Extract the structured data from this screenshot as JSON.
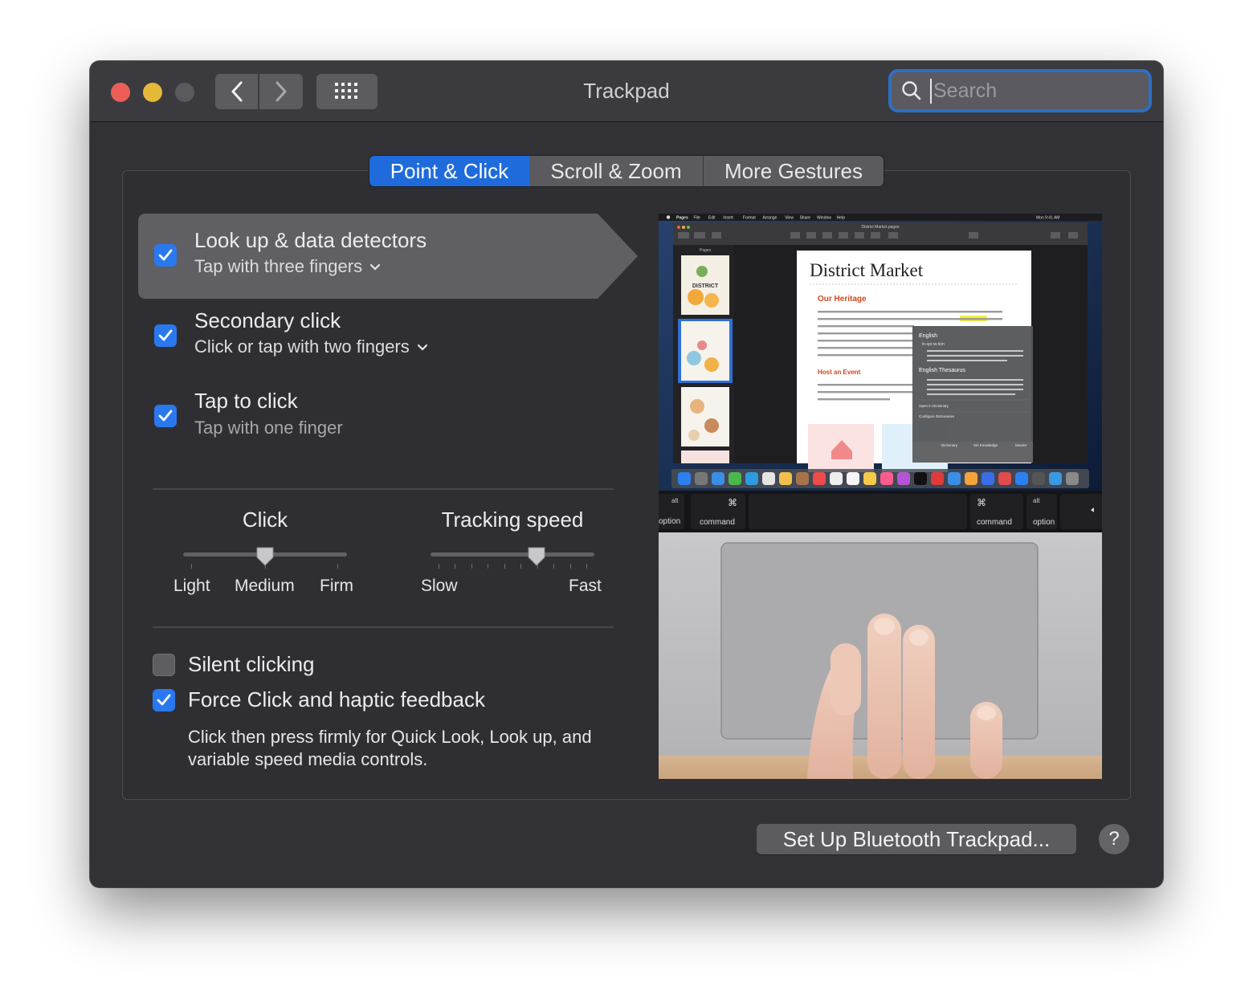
{
  "window": {
    "title": "Trackpad"
  },
  "search": {
    "placeholder": "Search",
    "value": ""
  },
  "tabs": [
    {
      "label": "Point & Click",
      "active": true
    },
    {
      "label": "Scroll & Zoom",
      "active": false
    },
    {
      "label": "More Gestures",
      "active": false
    }
  ],
  "options": [
    {
      "title": "Look up & data detectors",
      "subtitle": "Tap with three fingers",
      "checked": true,
      "has_menu": true,
      "selected": true
    },
    {
      "title": "Secondary click",
      "subtitle": "Click or tap with two fingers",
      "checked": true,
      "has_menu": true,
      "selected": false
    },
    {
      "title": "Tap to click",
      "subtitle": "Tap with one finger",
      "checked": true,
      "has_menu": false,
      "selected": false
    }
  ],
  "click_slider": {
    "title": "Click",
    "labels": [
      "Light",
      "Medium",
      "Firm"
    ],
    "value": "Medium",
    "level": 0.5
  },
  "tracking_slider": {
    "title": "Tracking speed",
    "min_label": "Slow",
    "max_label": "Fast",
    "level": 0.65,
    "ticks": 10
  },
  "silent_clicking": {
    "label": "Silent clicking",
    "checked": false
  },
  "force_click": {
    "label": "Force Click and haptic feedback",
    "checked": true,
    "description": "Click then press firmly for Quick Look, Look up, and variable speed media controls."
  },
  "preview": {
    "menu_bar": [
      "Pages",
      "File",
      "Edit",
      "Insert",
      "Format",
      "Arrange",
      "View",
      "Share",
      "Window",
      "Help"
    ],
    "clock": "Mon 9:41 AM",
    "doc_title": "District Market.pages",
    "sidebar_label": "Pages",
    "thumb_label": "DISTRICT",
    "doc_heading": "District Market",
    "section_1": "Our Heritage",
    "body_1": "Janet Millet's little sandwich truck sure has traveled far. A decade ago she opened a mobile sandwich shop in Northern California, taking inspiration from her native New Orleans and the broad",
    "section_2": "Host an Event",
    "body_2": "Whether you want to rent our space or have us service at all four locations (Brooklyn, London, can accommodate all appetites.",
    "popup_lang": "English",
    "popup_word": "in·spi·ra·tion",
    "popup_def": "the process of being mentally stimulated to do or feel something, especially to do something creative",
    "popup_thes": "English Thesaurus",
    "popup_syn": "STIMULUS, stimulation, motivation, motivating force",
    "popup_open": "Open in Dictionary",
    "popup_config": "Configure Dictionaries",
    "popup_tabs": [
      "Dictionary",
      "Siri Knowledge",
      "Movies"
    ],
    "keys": {
      "alt": "alt",
      "option": "option",
      "command": "command",
      "cmd_symbol": "⌘"
    }
  },
  "footer": {
    "bluetooth_button": "Set Up Bluetooth Trackpad...",
    "help": "?"
  },
  "colors": {
    "accent": "#1f6bdc",
    "checkbox": "#2a78f0",
    "window_bg": "#323236",
    "close": "#ed5e57",
    "minimize": "#e6b83a"
  }
}
